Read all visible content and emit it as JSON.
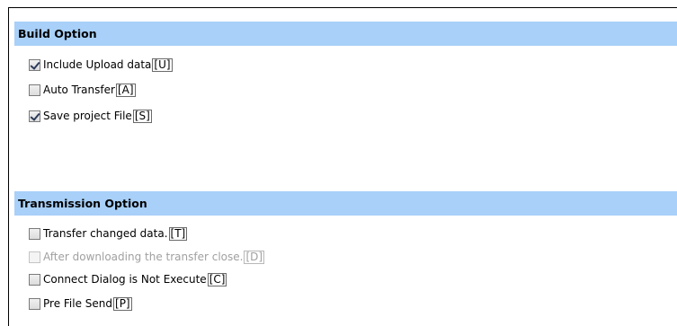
{
  "build_option": {
    "header": "Build Option",
    "items": [
      {
        "label": "Include Upload data",
        "hotkey": "[U]",
        "checked": true,
        "enabled": true
      },
      {
        "label": "Auto Transfer",
        "hotkey": "[A]",
        "checked": false,
        "enabled": true
      },
      {
        "label": "Save project File",
        "hotkey": "[S]",
        "checked": true,
        "enabled": true
      }
    ]
  },
  "transmission_option": {
    "header": "Transmission Option",
    "items": [
      {
        "label": "Transfer changed data.",
        "hotkey": "[T]",
        "checked": false,
        "enabled": true
      },
      {
        "label": "After downloading the transfer close.",
        "hotkey": "[D]",
        "checked": false,
        "enabled": false
      },
      {
        "label": "Connect Dialog is Not Execute",
        "hotkey": "[C]",
        "checked": false,
        "enabled": true
      },
      {
        "label": "Pre File Send",
        "hotkey": "[P]",
        "checked": false,
        "enabled": true
      }
    ]
  },
  "colors": {
    "header_bg": "#a8d0f8",
    "border": "#000000",
    "disabled_text": "#a0a0a0"
  }
}
